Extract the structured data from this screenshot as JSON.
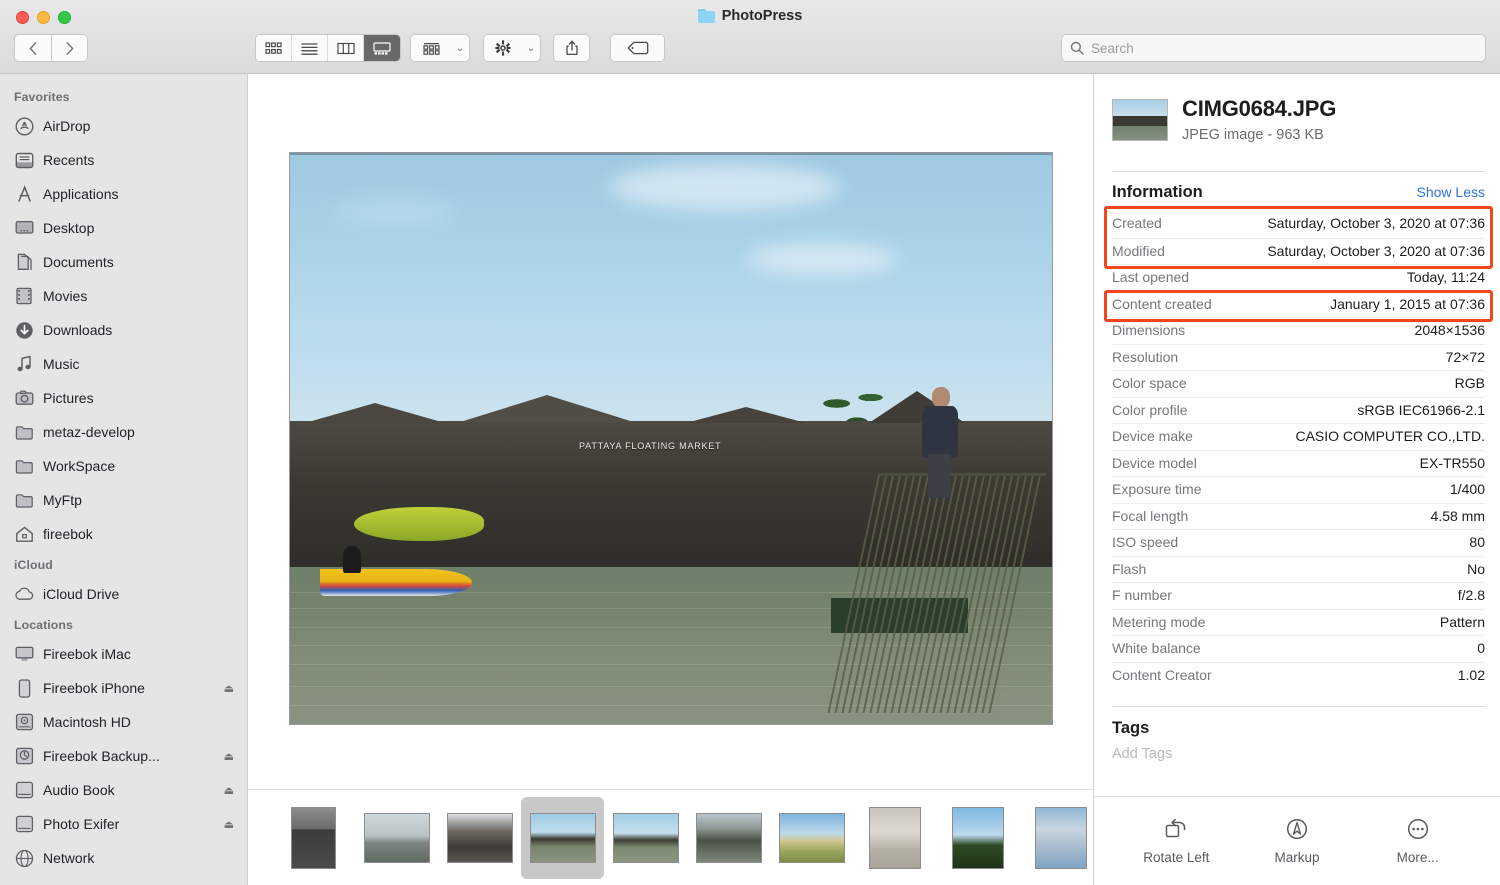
{
  "window": {
    "title": "PhotoPress",
    "folder_icon": "folder-icon"
  },
  "toolbar": {
    "back_icon": "chevron-left-icon",
    "forward_icon": "chevron-right-icon",
    "view_icon_label": "icon-view",
    "view_list_label": "list-view",
    "view_column_label": "column-view",
    "view_gallery_label": "gallery-view",
    "group_label": "group-items-by",
    "actions_label": "action-menu",
    "share_label": "share",
    "tags_label": "edit-tags"
  },
  "search": {
    "placeholder": "Search",
    "value": "",
    "icon": "search-icon"
  },
  "sidebar": {
    "sections": [
      {
        "title": "Favorites",
        "items": [
          {
            "label": "AirDrop",
            "icon": "airdrop-icon",
            "eject": false
          },
          {
            "label": "Recents",
            "icon": "recents-icon",
            "eject": false
          },
          {
            "label": "Applications",
            "icon": "applications-icon",
            "eject": false
          },
          {
            "label": "Desktop",
            "icon": "desktop-icon",
            "eject": false
          },
          {
            "label": "Documents",
            "icon": "documents-icon",
            "eject": false
          },
          {
            "label": "Movies",
            "icon": "movies-icon",
            "eject": false
          },
          {
            "label": "Downloads",
            "icon": "downloads-icon",
            "eject": false
          },
          {
            "label": "Music",
            "icon": "music-icon",
            "eject": false
          },
          {
            "label": "Pictures",
            "icon": "pictures-icon",
            "eject": false
          },
          {
            "label": "metaz-develop",
            "icon": "folder-icon",
            "eject": false
          },
          {
            "label": "WorkSpace",
            "icon": "folder-icon",
            "eject": false
          },
          {
            "label": "MyFtp",
            "icon": "folder-icon",
            "eject": false
          },
          {
            "label": "fireebok",
            "icon": "home-icon",
            "eject": false
          }
        ]
      },
      {
        "title": "iCloud",
        "items": [
          {
            "label": "iCloud Drive",
            "icon": "icloud-icon",
            "eject": false
          }
        ]
      },
      {
        "title": "Locations",
        "items": [
          {
            "label": "Fireebok iMac",
            "icon": "imac-icon",
            "eject": false
          },
          {
            "label": "Fireebok iPhone",
            "icon": "iphone-icon",
            "eject": true
          },
          {
            "label": "Macintosh HD",
            "icon": "harddisk-icon",
            "eject": false
          },
          {
            "label": "Fireebok Backup...",
            "icon": "timemachine-disk-icon",
            "eject": true
          },
          {
            "label": "Audio Book",
            "icon": "disk-icon",
            "eject": true
          },
          {
            "label": "Photo Exifer",
            "icon": "disk-icon",
            "eject": true
          },
          {
            "label": "Network",
            "icon": "network-icon",
            "eject": false
          }
        ]
      }
    ]
  },
  "preview": {
    "image_caption": "PATTAYA FLOATING MARKET",
    "eject_glyph": "⏏"
  },
  "filmstrip": {
    "selected_index": 3,
    "thumbs": [
      {
        "name": "thumb-portrait-bw",
        "orientation": "portrait",
        "kind": "bw-portrait"
      },
      {
        "name": "thumb-bridge",
        "orientation": "landscape",
        "kind": "bridge"
      },
      {
        "name": "thumb-market-roof",
        "orientation": "landscape",
        "kind": "roof"
      },
      {
        "name": "thumb-floating-market",
        "orientation": "landscape",
        "kind": "river"
      },
      {
        "name": "thumb-river-2",
        "orientation": "landscape",
        "kind": "river"
      },
      {
        "name": "thumb-canal",
        "orientation": "landscape",
        "kind": "canal"
      },
      {
        "name": "thumb-field",
        "orientation": "landscape",
        "kind": "field"
      },
      {
        "name": "thumb-interior",
        "orientation": "portrait",
        "kind": "interior"
      },
      {
        "name": "thumb-palm-sky",
        "orientation": "portrait",
        "kind": "palm"
      },
      {
        "name": "thumb-clouds",
        "orientation": "portrait",
        "kind": "clouds"
      },
      {
        "name": "thumb-partial",
        "orientation": "portrait",
        "kind": "clouds"
      }
    ]
  },
  "info_panel": {
    "file_name": "CIMG0684.JPG",
    "file_subtitle": "JPEG image - 963 KB",
    "section_title": "Information",
    "toggle_label": "Show Less",
    "rows": [
      {
        "key": "Created",
        "value": "Saturday, October 3, 2020 at 07:36"
      },
      {
        "key": "Modified",
        "value": "Saturday, October 3, 2020 at 07:36"
      },
      {
        "key": "Last opened",
        "value": "Today, 11:24"
      },
      {
        "key": "Content created",
        "value": "January 1, 2015 at 07:36"
      },
      {
        "key": "Dimensions",
        "value": "2048×1536"
      },
      {
        "key": "Resolution",
        "value": "72×72"
      },
      {
        "key": "Color space",
        "value": "RGB"
      },
      {
        "key": "Color profile",
        "value": "sRGB IEC61966-2.1"
      },
      {
        "key": "Device make",
        "value": "CASIO COMPUTER CO.,LTD."
      },
      {
        "key": "Device model",
        "value": "EX-TR550"
      },
      {
        "key": "Exposure time",
        "value": "1/400"
      },
      {
        "key": "Focal length",
        "value": "4.58 mm"
      },
      {
        "key": "ISO speed",
        "value": "80"
      },
      {
        "key": "Flash",
        "value": "No"
      },
      {
        "key": "F number",
        "value": "f/2.8"
      },
      {
        "key": "Metering mode",
        "value": "Pattern"
      },
      {
        "key": "White balance",
        "value": "0"
      },
      {
        "key": "Content Creator",
        "value": "1.02"
      }
    ],
    "tags_title": "Tags",
    "tags_placeholder": "Add Tags",
    "highlight_color": "#f4461c",
    "link_color": "#2f72de",
    "actions": [
      {
        "label": "Rotate Left",
        "icon": "rotate-left-icon"
      },
      {
        "label": "Markup",
        "icon": "markup-icon"
      },
      {
        "label": "More...",
        "icon": "more-icon"
      }
    ]
  }
}
